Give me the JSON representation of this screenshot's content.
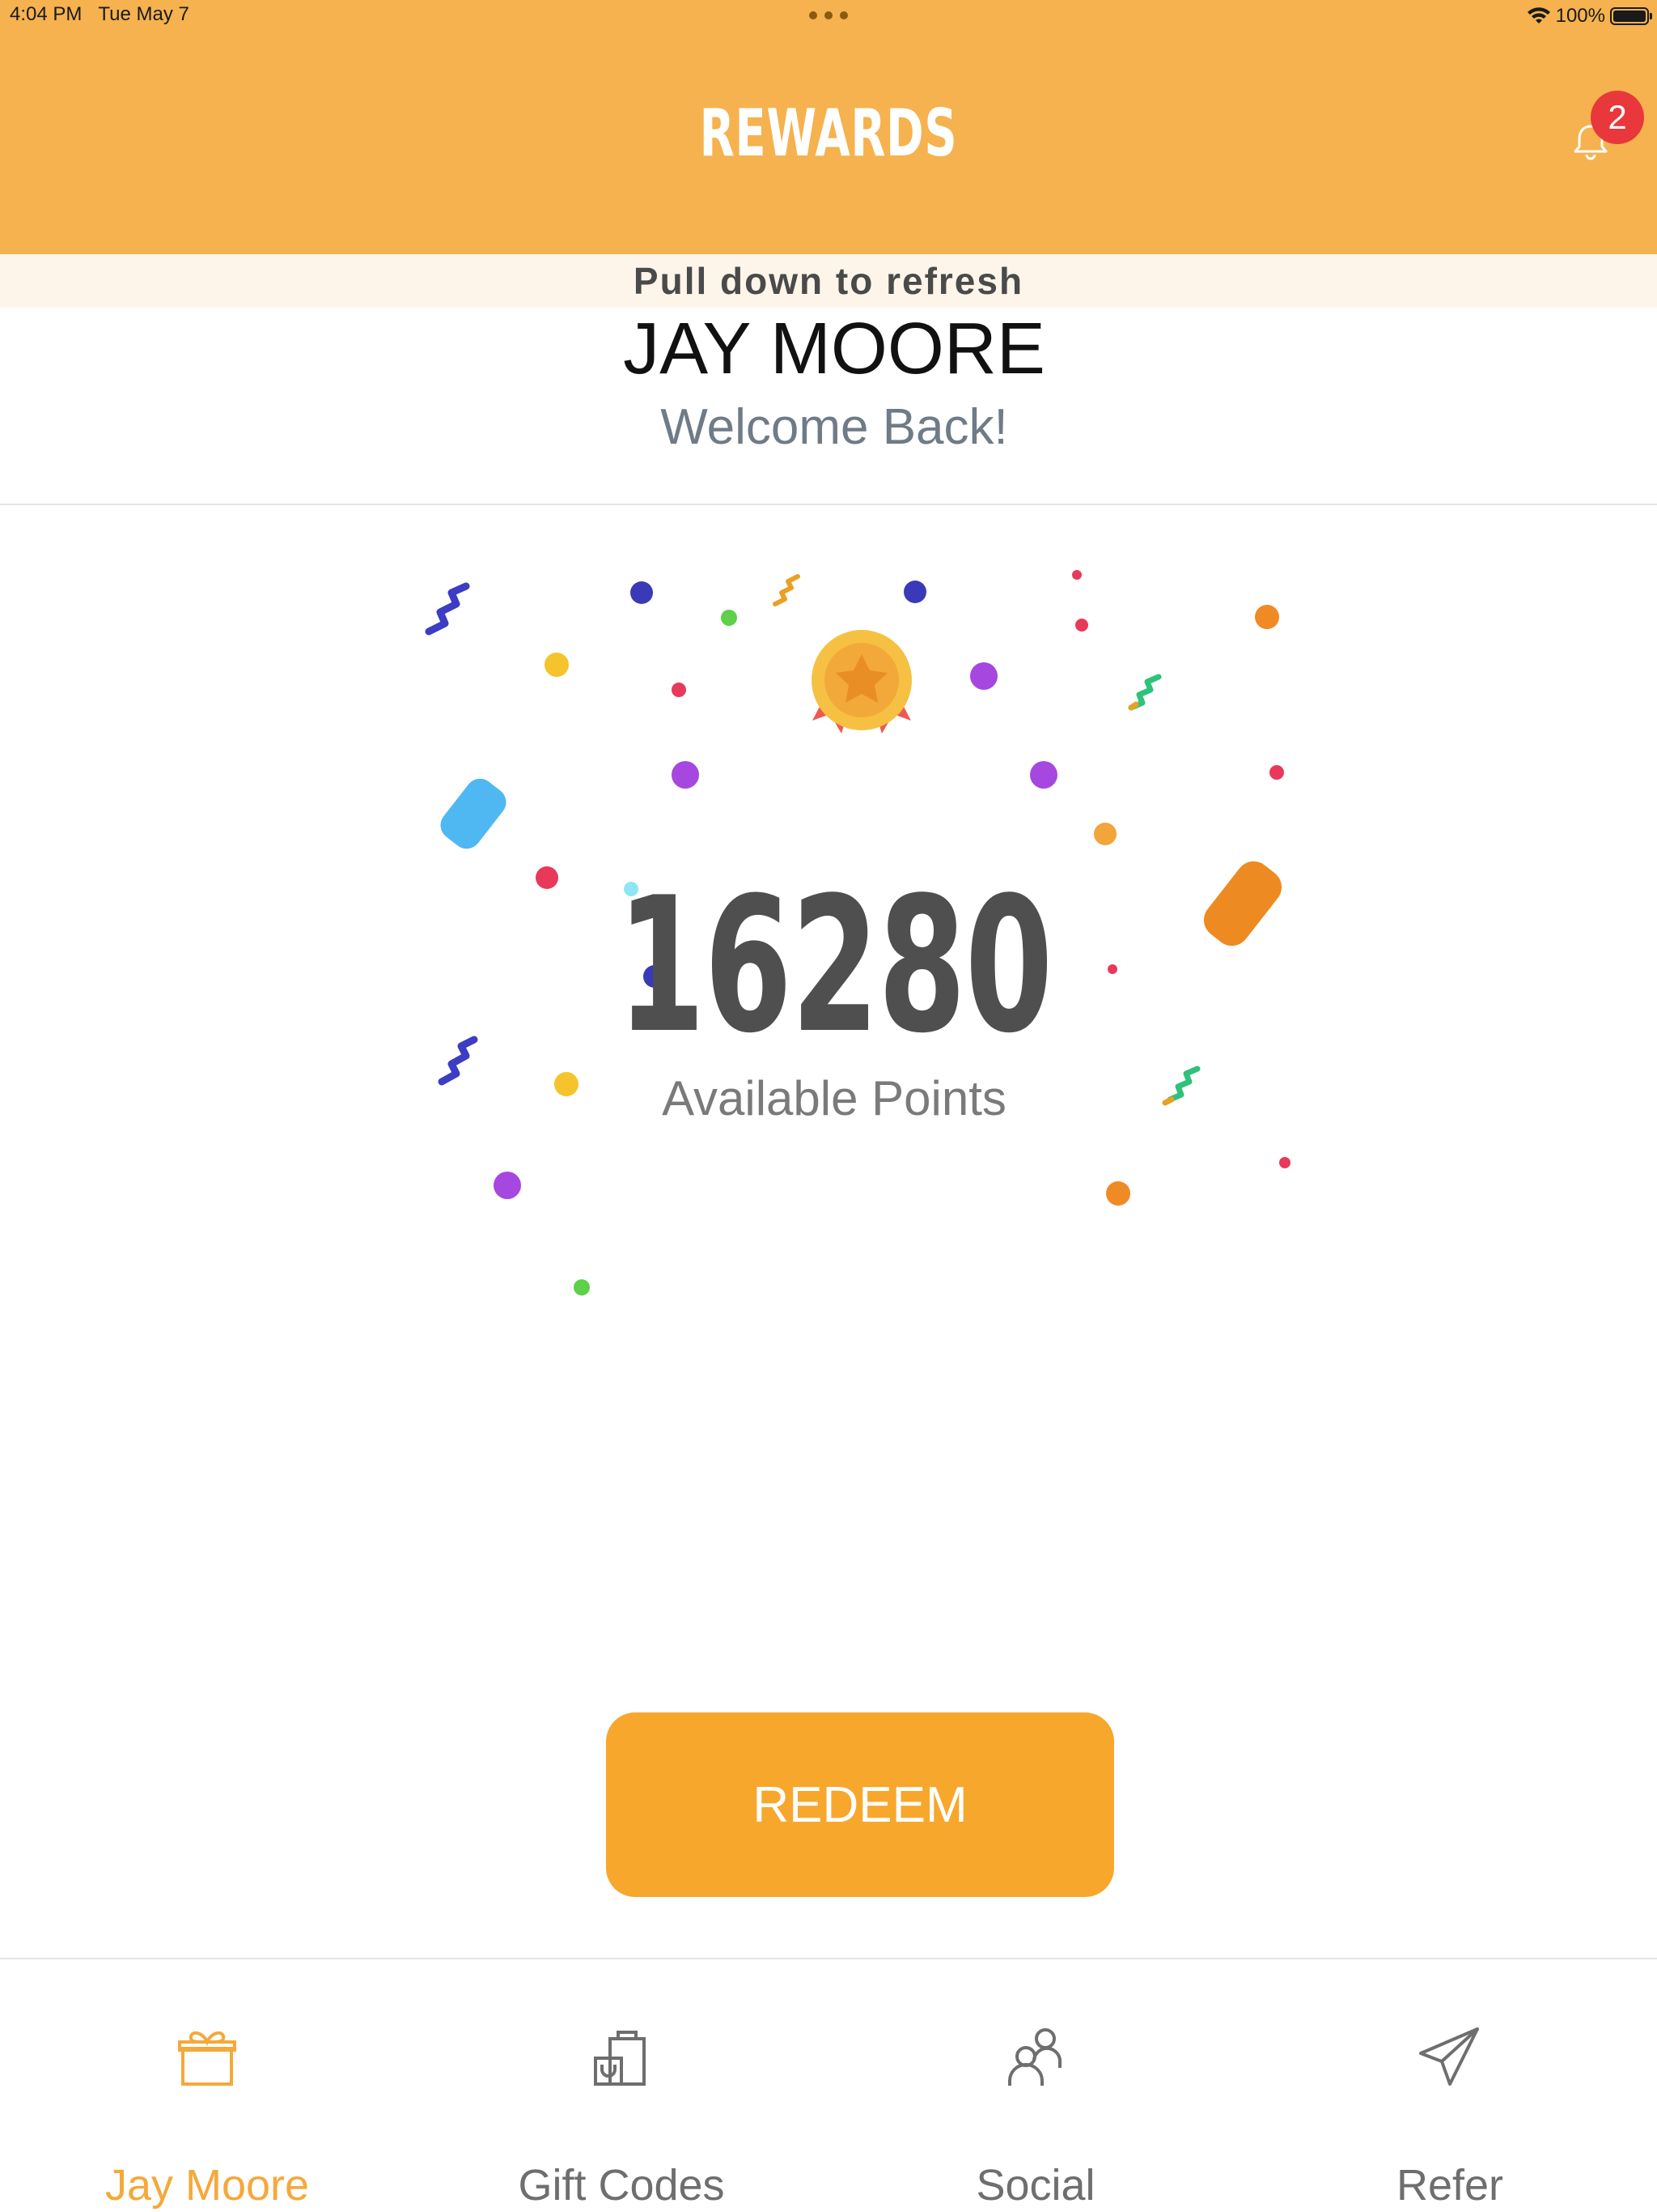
{
  "status_bar": {
    "time": "4:04 PM",
    "date": "Tue May 7",
    "battery": "100%"
  },
  "header": {
    "title": "REWARDS",
    "notification_count": "2"
  },
  "refresh_hint": "Pull down to refresh",
  "user": {
    "name": "JAY MOORE",
    "greeting": "Welcome Back!"
  },
  "points": {
    "value": "16280",
    "label": "Available Points"
  },
  "redeem_label": "REDEEM",
  "tabs": [
    {
      "label": "Jay Moore",
      "icon": "gift-icon",
      "active": true
    },
    {
      "label": "Gift Codes",
      "icon": "shopping-bag-icon",
      "active": false
    },
    {
      "label": "Social",
      "icon": "users-icon",
      "active": false
    },
    {
      "label": "Refer",
      "icon": "paper-plane-icon",
      "active": false
    }
  ],
  "colors": {
    "header": "#F5B24E",
    "accent": "#F8A72D",
    "badge": "#E8383B",
    "active_tab": "#F4A93B"
  }
}
